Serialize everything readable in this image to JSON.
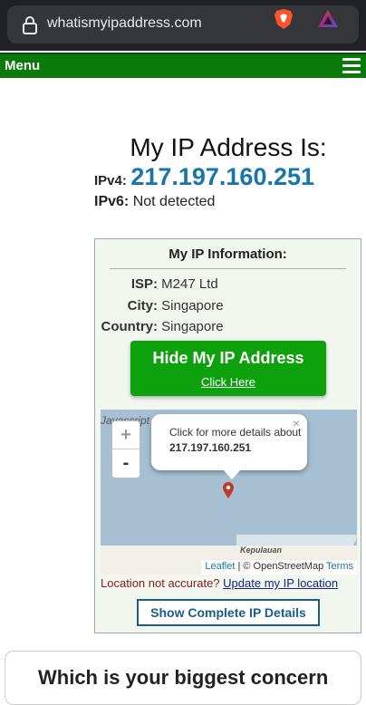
{
  "browser": {
    "url": "whatismyipaddress.com",
    "lock_icon": "lock-icon",
    "brave_icon": "brave-shield-icon",
    "rewards_icon": "brave-rewards-icon"
  },
  "nav": {
    "menu_label": "Menu",
    "hamburger_icon": "hamburger-icon"
  },
  "hero": {
    "title": "My IP Address Is:",
    "ipv4_label": "IPv4:",
    "ipv4_value": "217.197.160.251",
    "ipv6_label": "IPv6:",
    "ipv6_value": "Not detected"
  },
  "info": {
    "title": "My IP Information:",
    "rows": [
      {
        "key": "ISP:",
        "value": "M247 Ltd"
      },
      {
        "key": "City:",
        "value": "Singapore"
      },
      {
        "key": "Country:",
        "value": "Singapore"
      }
    ],
    "hide_button": {
      "title": "Hide My IP Address",
      "subtitle": "Click Here"
    },
    "map": {
      "background_text": "Javascript disabled ... not available.",
      "zoom_in": "+",
      "zoom_out": "-",
      "popup_text": "Click for more details about",
      "popup_ip": "217.197.160.251",
      "popup_close": "×",
      "place_label": "Kepulauan",
      "attrib_leaflet": "Leaflet",
      "attrib_osm": "| © OpenStreetMap",
      "attrib_terms": "Terms"
    },
    "location_question": "Location not accurate?",
    "location_link": "Update my IP location",
    "details_button": "Show Complete IP Details"
  },
  "bottom": {
    "heading": "Which is your biggest concern"
  },
  "colors": {
    "nav_green": "#0a7a0a",
    "ip_blue": "#1777a8",
    "button_green": "#0ea10e",
    "box_bg": "#f1f6ef",
    "map_water": "#a6bfd3"
  }
}
